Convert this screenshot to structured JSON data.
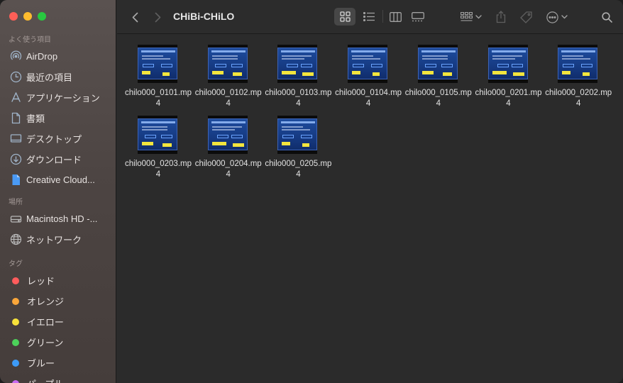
{
  "window": {
    "title": "CHiBi-CHiLO"
  },
  "sidebar": {
    "favorites_heading": "よく使う項目",
    "favorites": [
      {
        "label": "AirDrop",
        "icon": "airdrop-icon"
      },
      {
        "label": "最近の項目",
        "icon": "clock-icon"
      },
      {
        "label": "アプリケーション",
        "icon": "applications-icon"
      },
      {
        "label": "書類",
        "icon": "document-icon"
      },
      {
        "label": "デスクトップ",
        "icon": "desktop-icon"
      },
      {
        "label": "ダウンロード",
        "icon": "download-icon"
      },
      {
        "label": "Creative Cloud...",
        "icon": "creative-cloud-file-icon"
      }
    ],
    "locations_heading": "場所",
    "locations": [
      {
        "label": "Macintosh HD -...",
        "icon": "hard-drive-icon"
      },
      {
        "label": "ネットワーク",
        "icon": "network-globe-icon"
      }
    ],
    "tags_heading": "タグ",
    "tags": [
      {
        "label": "レッド",
        "color": "#ff5c5c"
      },
      {
        "label": "オレンジ",
        "color": "#f9a63a"
      },
      {
        "label": "イエロー",
        "color": "#f7e23a"
      },
      {
        "label": "グリーン",
        "color": "#4cd15a"
      },
      {
        "label": "ブルー",
        "color": "#3d9bf7"
      },
      {
        "label": "パープル",
        "color": "#c86af0"
      }
    ]
  },
  "toolbar": {
    "back": "back-chevron-icon",
    "forward": "forward-chevron-icon",
    "view_modes": [
      "icon-view-icon",
      "list-view-icon",
      "column-view-icon",
      "gallery-view-icon"
    ],
    "active_view": "icon-view-icon"
  },
  "files": [
    {
      "name": "chilo000_0101.mp4"
    },
    {
      "name": "chilo000_0102.mp4"
    },
    {
      "name": "chilo000_0103.mp4"
    },
    {
      "name": "chilo000_0104.mp4"
    },
    {
      "name": "chilo000_0105.mp4"
    },
    {
      "name": "chilo000_0201.mp4"
    },
    {
      "name": "chilo000_0202.mp4"
    },
    {
      "name": "chilo000_0203.mp4"
    },
    {
      "name": "chilo000_0204.mp4"
    },
    {
      "name": "chilo000_0205.mp4"
    }
  ]
}
